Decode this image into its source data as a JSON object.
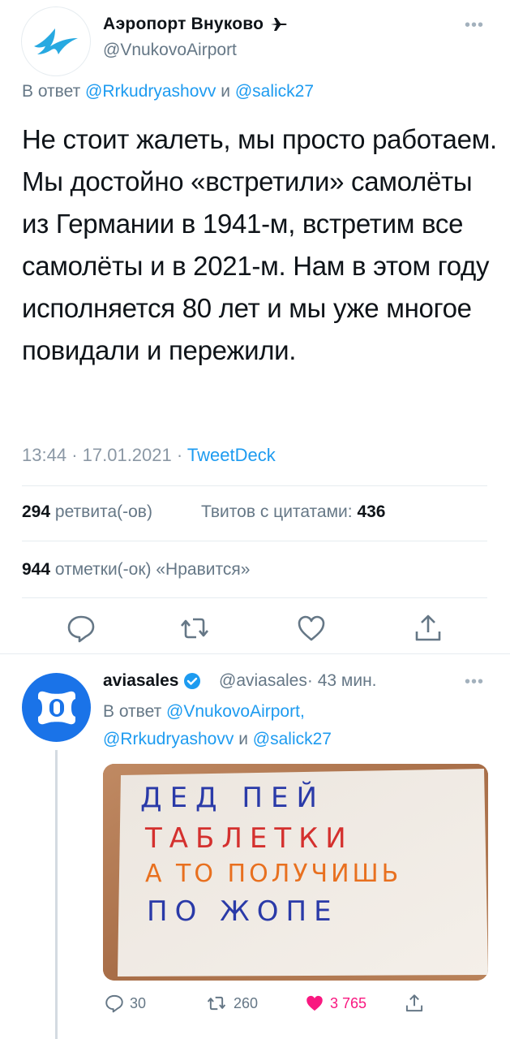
{
  "main_tweet": {
    "author_name": "Аэропорт Внуково",
    "author_handle": "@VnukovoAirport",
    "reply_prefix": "В ответ",
    "reply_user1": "@Rrkudryashovv",
    "reply_and": "и",
    "reply_user2": "@salick27",
    "text": "Не стоит жалеть, мы просто работаем. Мы достойно «встретили» самолёты из Германии в 1941-м, встретим все самолёты и в 2021-м. Нам в этом году исполняется 80 лет и мы уже многое повидали и пережили.",
    "time": "13:44",
    "date": "17.01.2021",
    "source": "TweetDeck",
    "retweets_count": "294",
    "retweets_label": "ретвита(-ов)",
    "quotes_label": "Твитов с цитатами:",
    "quotes_count": "436",
    "likes_count": "944",
    "likes_label": "отметки(-ок) «Нравится»",
    "dot": "·"
  },
  "reply_tweet": {
    "author_name": "aviasales",
    "author_handle": "@aviasales",
    "time_ago": "43 мин.",
    "reply_prefix": "В ответ",
    "reply_user1": "@VnukovoAirport,",
    "reply_user2": "@Rrkudryashovv",
    "reply_and": "и",
    "reply_user3": "@salick27",
    "media_lines": [
      "ДЕД ПЕЙ",
      "ТАБЛЕТКИ",
      "А ТО ПОЛУЧИШЬ",
      "ПО ЖОПЕ"
    ],
    "replies": "30",
    "retweets": "260",
    "likes": "3 765"
  },
  "colors": {
    "link": "#1d9bf0",
    "like": "#f91880",
    "avatar_reply_bg": "#1a73e8"
  },
  "icons": [
    "vnukovo-logo-icon",
    "airplane-icon",
    "more-icon",
    "reply-icon",
    "retweet-icon",
    "like-icon",
    "share-icon",
    "verified-icon",
    "aviasales-logo-icon"
  ]
}
